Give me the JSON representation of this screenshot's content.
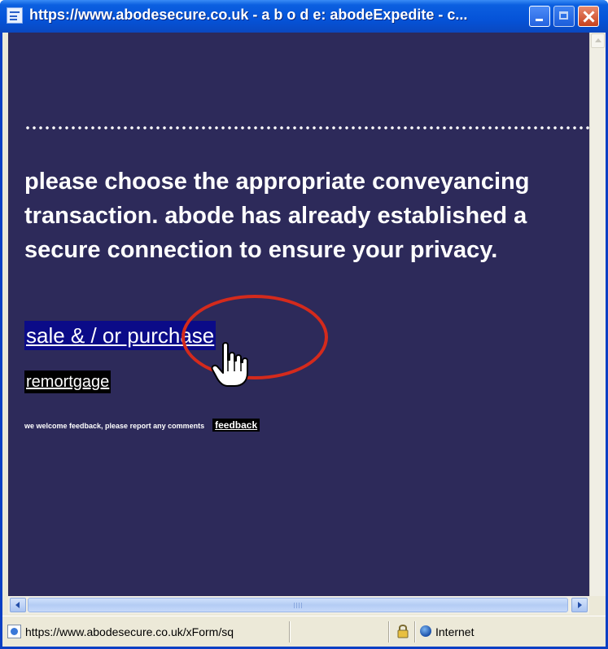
{
  "window": {
    "title": "https://www.abodesecure.co.uk - a b o d e: abodeExpedite - c..."
  },
  "main": {
    "heading": "please choose the appropriate conveyancing transaction. abode has already established a secure connection to ensure your privacy.",
    "options": [
      {
        "label": "sale & / or purchase"
      },
      {
        "label": "remortgage"
      }
    ],
    "feedback_text": "we welcome feedback, please report any comments",
    "feedback_link": "feedback"
  },
  "statusbar": {
    "url": "https://www.abodesecure.co.uk/xForm/sq",
    "zone": "Internet"
  },
  "colors": {
    "page_background": "#2d2a5a",
    "highlight_link_background": "#0b0b88",
    "annotation_circle": "#d42a1c",
    "titlebar": "#0553d8"
  },
  "icons": [
    "window-icon",
    "minimize-icon",
    "maximize-icon",
    "close-icon",
    "hand-cursor-icon",
    "scroll-left-icon",
    "scroll-right-icon",
    "scroll-up-icon",
    "page-icon",
    "lock-icon",
    "globe-icon"
  ]
}
